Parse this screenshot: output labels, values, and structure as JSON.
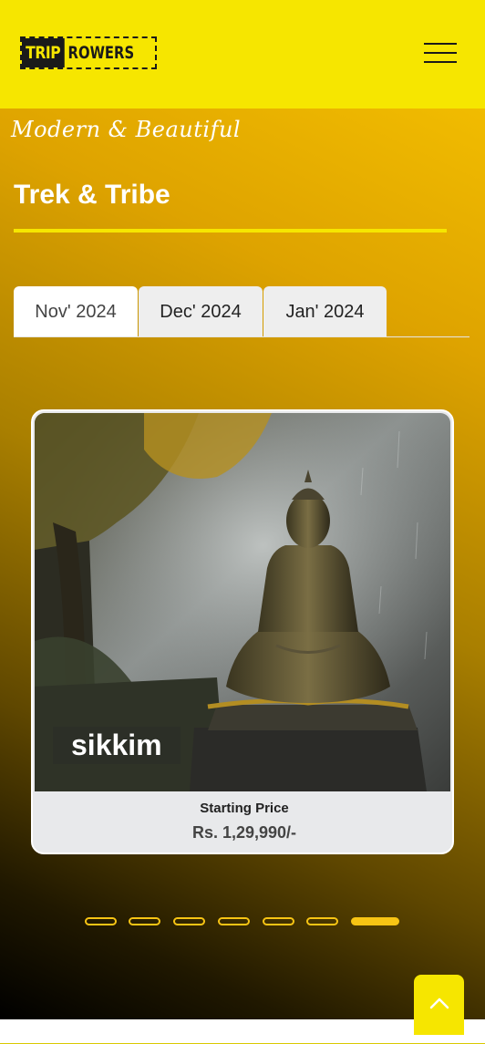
{
  "header": {
    "logo_left": "TRIP",
    "logo_right": "ROWERS",
    "menu_icon": "hamburger-menu-icon",
    "background_color": "#f6e600"
  },
  "hero": {
    "tagline": "Modern & Beautiful",
    "title": "Trek & Tribe",
    "accent_color": "#f6e600"
  },
  "tabs": [
    {
      "label": "Nov' 2024",
      "active": true
    },
    {
      "label": "Dec' 2024",
      "active": false
    },
    {
      "label": "Jan' 2024",
      "active": false
    }
  ],
  "card": {
    "place": "sikkim",
    "price_label": "Starting Price",
    "price": "Rs. 1,29,990/-",
    "image_icon": "buddha-statue-image"
  },
  "carousel": {
    "total_slides": 7,
    "active_slide": 7,
    "dot_color": "#f7c414"
  },
  "scroll_top": {
    "icon": "chevron-up-icon"
  }
}
